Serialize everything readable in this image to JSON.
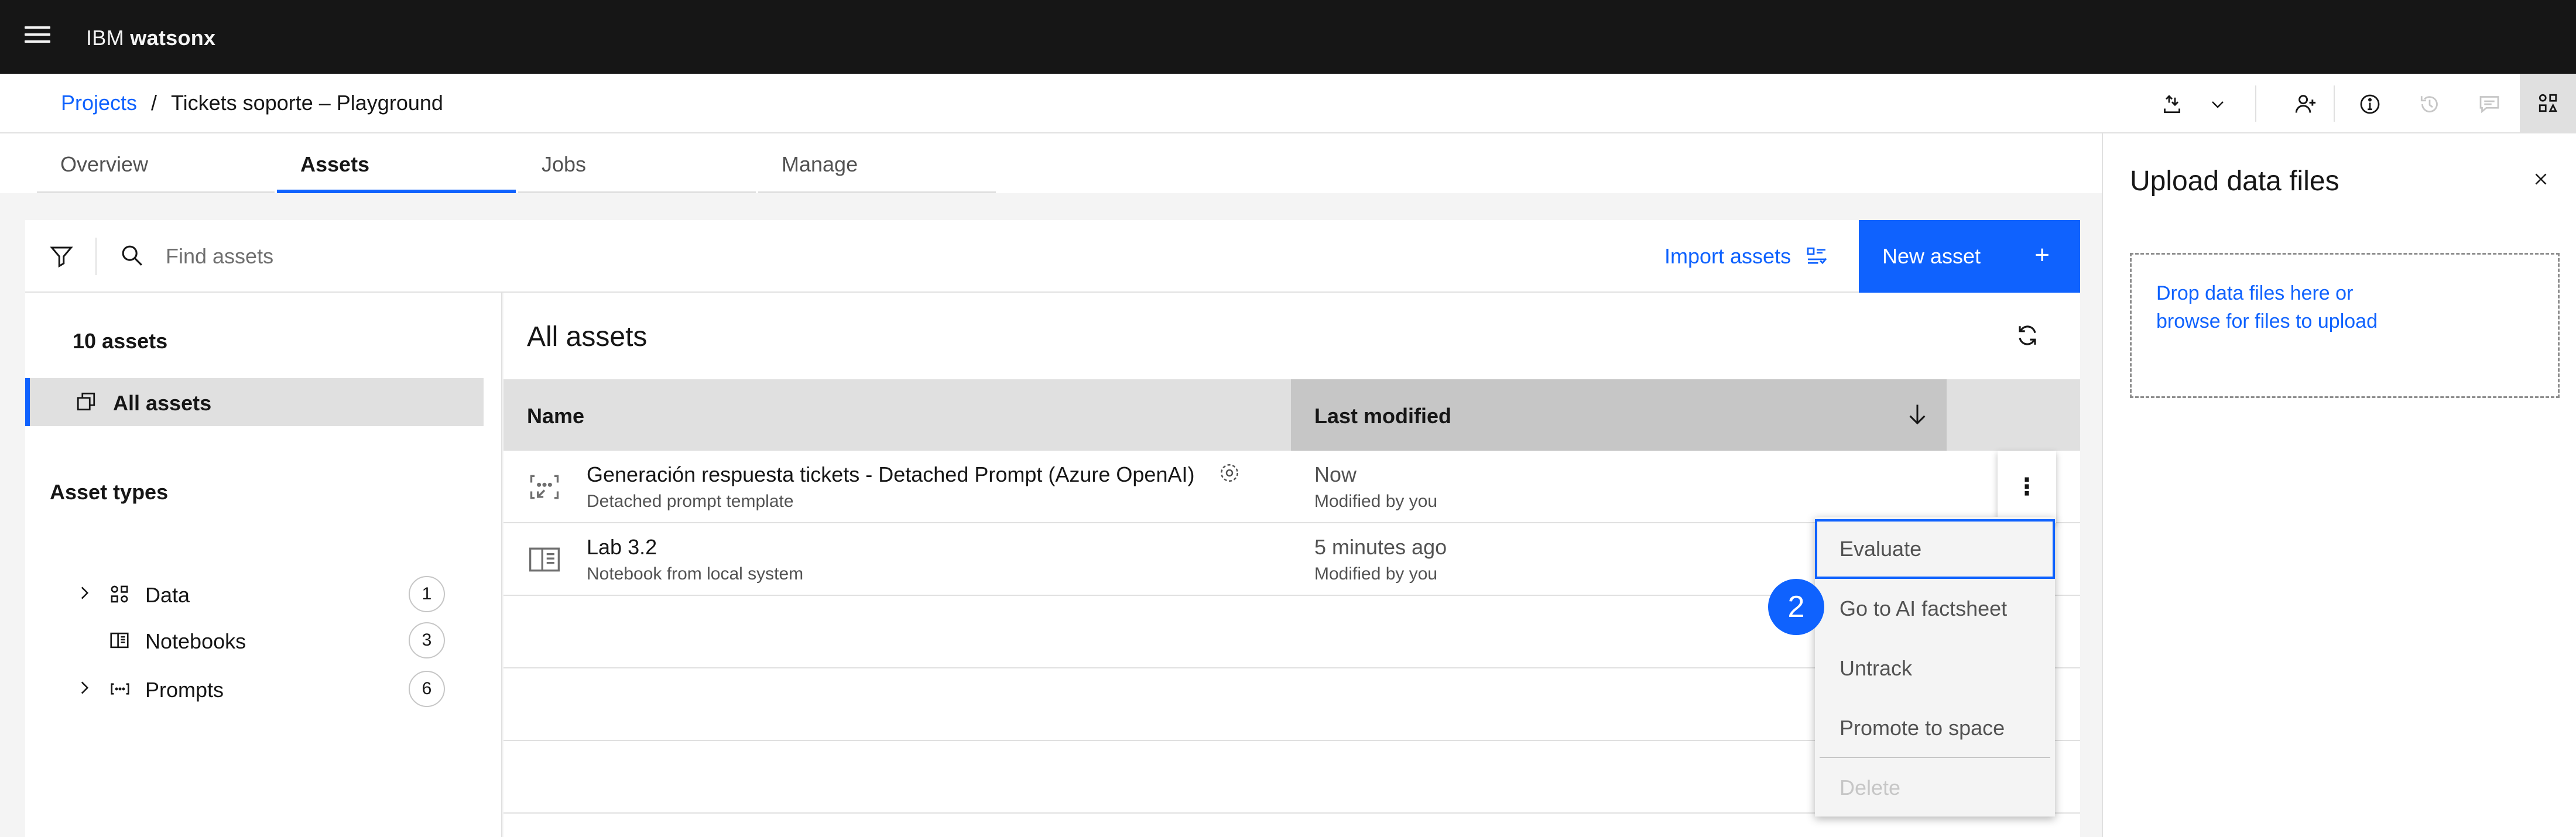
{
  "topbar": {
    "brand_prefix": "IBM",
    "brand_name": "watsonx"
  },
  "breadcrumb": {
    "parent": "Projects",
    "separator": "/",
    "current": "Tickets soporte – Playground"
  },
  "header_icons": [
    "upload-icon",
    "chevron-down-icon",
    "add-collaborator-icon",
    "information-icon",
    "history-icon",
    "chat-icon",
    "asset-panel-icon"
  ],
  "tabs": [
    {
      "label": "Overview",
      "selected": false
    },
    {
      "label": "Assets",
      "selected": true
    },
    {
      "label": "Jobs",
      "selected": false
    },
    {
      "label": "Manage",
      "selected": false
    }
  ],
  "toolbar": {
    "search_placeholder": "Find assets",
    "import_label": "Import assets",
    "new_label": "New asset"
  },
  "sidebar": {
    "count": "10 assets",
    "all_label": "All assets",
    "types_title": "Asset types",
    "types": [
      {
        "label": "Data",
        "count": "1"
      },
      {
        "label": "Notebooks",
        "count": "3"
      },
      {
        "label": "Prompts",
        "count": "6"
      }
    ]
  },
  "main": {
    "title": "All assets",
    "columns": {
      "name": "Name",
      "modified": "Last modified"
    },
    "rows": [
      {
        "name": "Generación respuesta tickets - Detached Prompt (Azure OpenAI)",
        "type": "Detached prompt template",
        "modified": "Now",
        "by": "Modified by you"
      },
      {
        "name": "Lab 3.2",
        "type": "Notebook from local system",
        "modified": "5 minutes ago",
        "by": "Modified by you"
      }
    ]
  },
  "menu": {
    "items": [
      {
        "label": "Evaluate",
        "state": "focused"
      },
      {
        "label": "Go to AI factsheet",
        "state": "normal"
      },
      {
        "label": "Untrack",
        "state": "normal"
      },
      {
        "label": "Promote to space",
        "state": "normal"
      },
      {
        "label": "Delete",
        "state": "disabled"
      }
    ]
  },
  "step_badge": "2",
  "upload_panel": {
    "title": "Upload data files",
    "drop_line1": "Drop data files here or",
    "drop_line2": "browse for files to upload"
  },
  "colors": {
    "accent": "#0f62fe",
    "topbar": "#161616",
    "surface": "#ffffff",
    "background": "#f4f4f4"
  }
}
